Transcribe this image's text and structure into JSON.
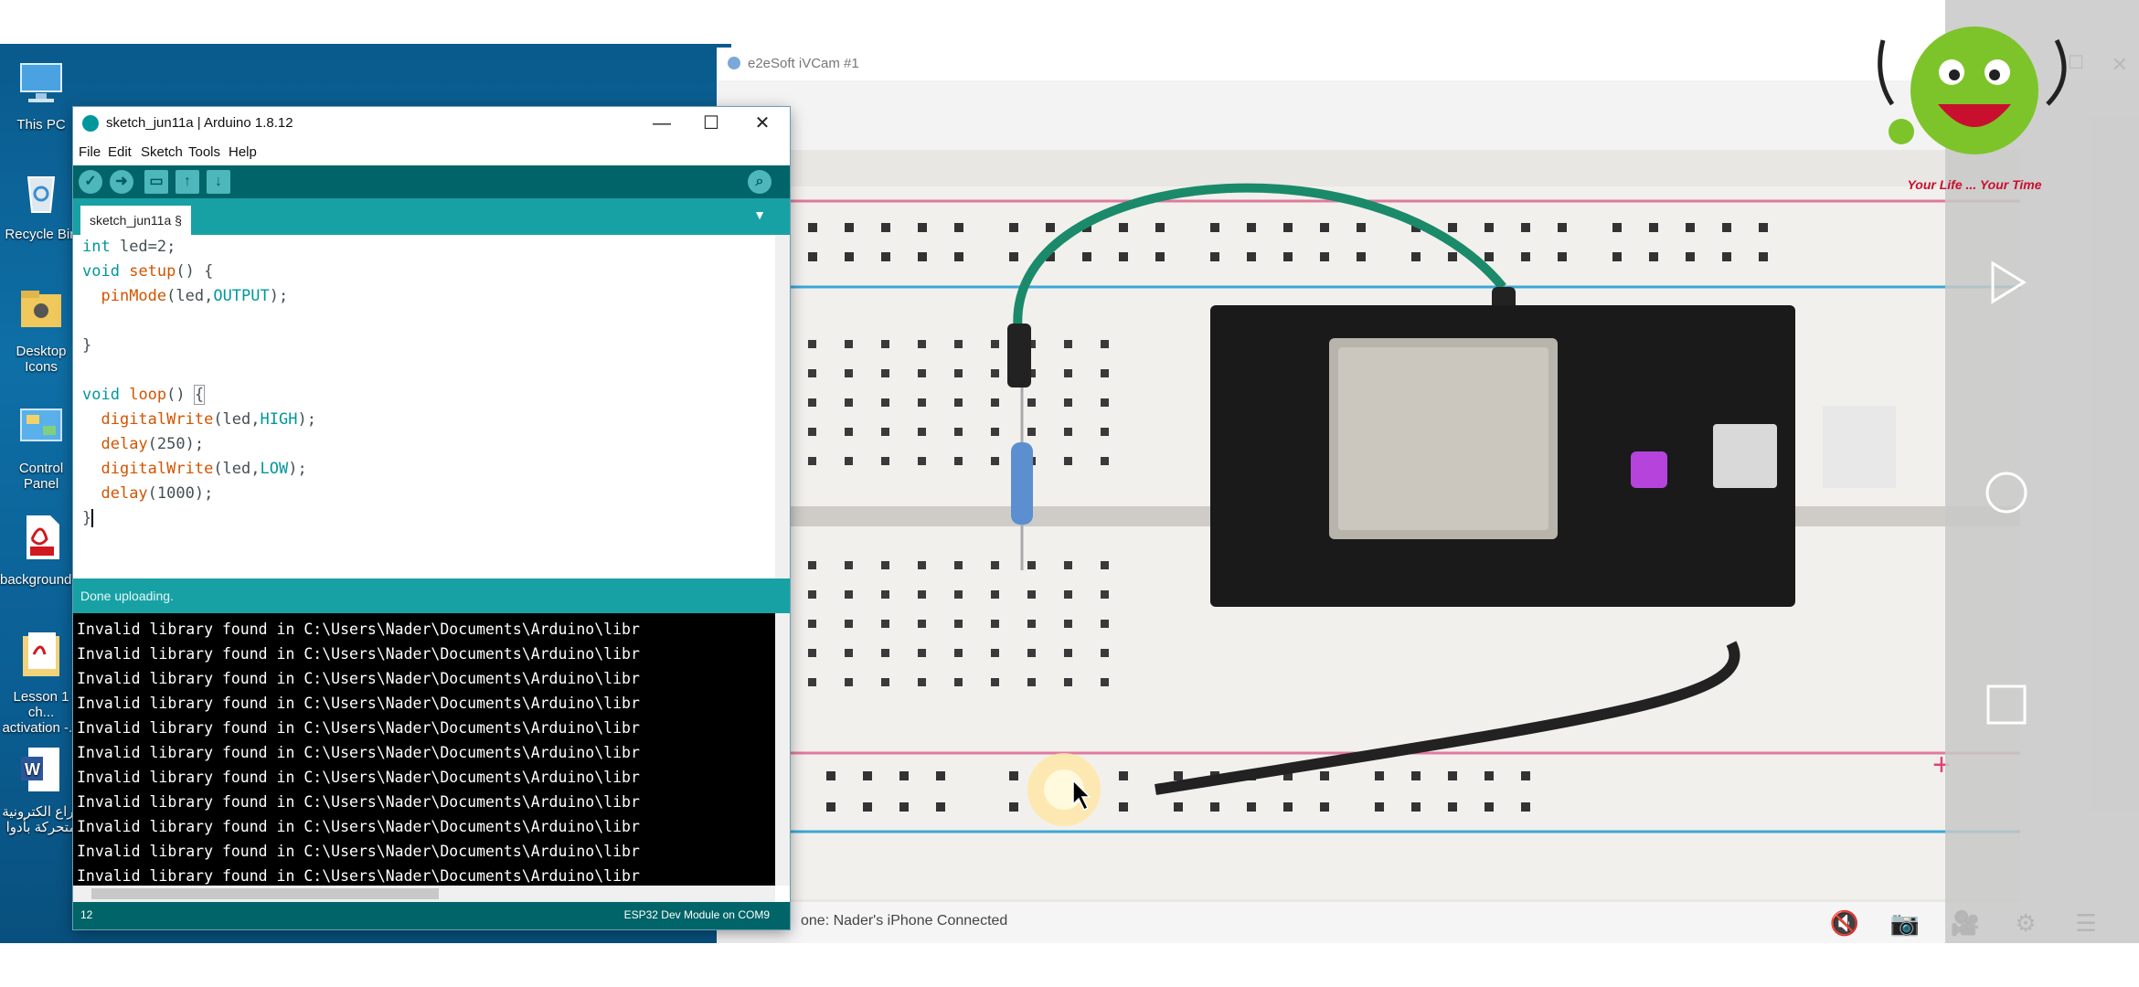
{
  "desktop": {
    "icons": [
      {
        "label": "This PC",
        "icon": "computer-icon"
      },
      {
        "label": "Recycle Bin",
        "icon": "recycle-bin-icon"
      },
      {
        "label": "Desktop Icons",
        "icon": "folder-icon"
      },
      {
        "label": "Control Panel",
        "icon": "control-panel-icon"
      },
      {
        "label": "background...",
        "icon": "pdf-icon"
      },
      {
        "label": "Lesson 1 ch... activation -...",
        "icon": "pdf-file-icon"
      },
      {
        "label": "زراع الكترونية متحركة بأدوا",
        "icon": "word-doc-icon"
      }
    ]
  },
  "ivcam": {
    "title": "e2eSoft iVCam #1",
    "status": "one: Nader's iPhone Connected",
    "status_icons": [
      "mute-icon",
      "camera-icon",
      "video-icon",
      "settings-icon",
      "menu-icon"
    ]
  },
  "logo": {
    "tagline": "Your Life ... Your Time"
  },
  "arduino": {
    "title": "sketch_jun11a | Arduino 1.8.12",
    "menu": [
      "File",
      "Edit",
      "Sketch",
      "Tools",
      "Help"
    ],
    "tab": "sketch_jun11a §",
    "code": [
      "int led=2;",
      "void setup() {",
      "  pinMode(led,OUTPUT);",
      "",
      "}",
      "",
      "void loop() {",
      "  digitalWrite(led,HIGH);",
      "  delay(250);",
      "  digitalWrite(led,LOW);",
      "  delay(1000);",
      "}"
    ],
    "message": "Done uploading.",
    "console_line": "Invalid library found in C:\\Users\\Nader\\Documents\\Arduino\\libr",
    "console_count": 11,
    "line_number": "12",
    "board": "ESP32 Dev Module on COM9"
  },
  "colors": {
    "arduino_teal_dark": "#006468",
    "arduino_teal": "#17a1a5",
    "desktop_blue": "#0e6fa6"
  }
}
